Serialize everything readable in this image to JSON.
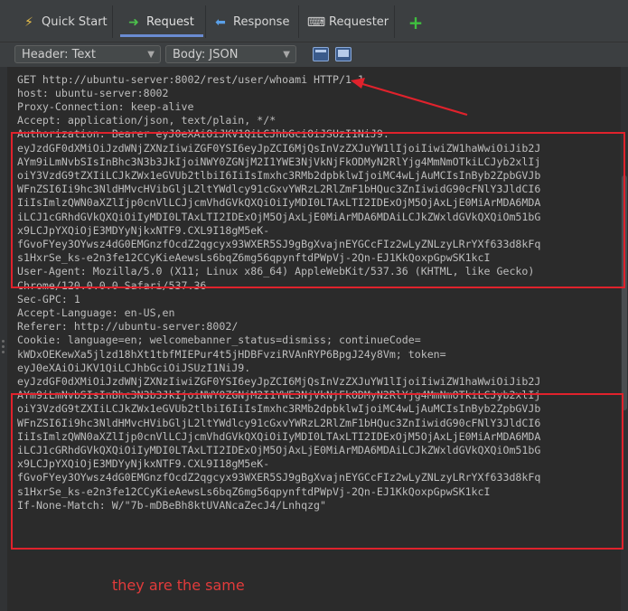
{
  "tabs": [
    {
      "label": "Quick Start",
      "icon": "lightning-icon"
    },
    {
      "label": "Request",
      "icon": "arrow-right-icon",
      "active": true
    },
    {
      "label": "Response",
      "icon": "arrow-left-icon"
    },
    {
      "label": "Requester",
      "icon": "requester-icon"
    }
  ],
  "add_tab_icon": "plus-icon",
  "toolbar": {
    "header_select": "Header: Text",
    "body_select": "Body: JSON"
  },
  "request_lines": [
    "GET http://ubuntu-server:8002/rest/user/whoami HTTP/1.1",
    "host: ubuntu-server:8002",
    "Proxy-Connection: keep-alive",
    "Accept: application/json, text/plain, */*",
    "Authorization: Bearer eyJ0eXAiOiJKV1QiLCJhbGciOiJSUzI1NiJ9.",
    "eyJzdGF0dXMiOiJzdWNjZXNzIiwiZGF0YSI6eyJpZCI6MjQsInVzZXJuYW1lIjoiIiwiZW1haWwiOiJib2J",
    "AYm9iLmNvbSIsInBhc3N3b3JkIjoiNWY0ZGNjM2I1YWE3NjVkNjFkODMyN2RlYjg4MmNmOTkiLCJyb2xlIj",
    "oiY3VzdG9tZXIiLCJkZWx1eGVUb2tlbiI6IiIsImxhc3RMb2dpbklwIjoiMC4wLjAuMCIsInByb2ZpbGVJb",
    "WFnZSI6Ii9hc3NldHMvcHVibGljL2ltYWdlcy91cGxvYWRzL2RlZmF1bHQuc3ZnIiwidG90cFNlY3JldCI6",
    "IiIsImlzQWN0aXZlIjp0cnVlLCJjcmVhdGVkQXQiOiIyMDI0LTAxLTI2IDExOjM5OjAxLjE0MiArMDA6MDA",
    "iLCJ1cGRhdGVkQXQiOiIyMDI0LTAxLTI2IDExOjM5OjAxLjE0MiArMDA6MDAiLCJkZWxldGVkQXQiOm51bG",
    "x9LCJpYXQiOjE3MDYyNjkxNTF9.CXL9I18gM5eK-",
    "fGvoFYey3OYwsz4dG0EMGnzfOcdZ2qgcyx93WXER5SJ9gBgXvajnEYGCcFIz2wLyZNLzyLRrYXf633d8kFq",
    "s1HxrSe_ks-e2n3fe12CCyKieAewsLs6bqZ6mg56qpynftdPWpVj-2Qn-EJ1KkQoxpGpwSK1kcI",
    "User-Agent: Mozilla/5.0 (X11; Linux x86_64) AppleWebKit/537.36 (KHTML, like Gecko)",
    "Chrome/120.0.0.0 Safari/537.36",
    "Sec-GPC: 1",
    "Accept-Language: en-US,en",
    "Referer: http://ubuntu-server:8002/",
    "Cookie: language=en; welcomebanner_status=dismiss; continueCode=",
    "kWDxOEKewXa5jlzd18hXt1tbfMIEPur4t5jHDBFvziRVAnRYP6BpgJ24y8Vm; token=",
    "eyJ0eXAiOiJKV1QiLCJhbGciOiJSUzI1NiJ9.",
    "eyJzdGF0dXMiOiJzdWNjZXNzIiwiZGF0YSI6eyJpZCI6MjQsInVzZXJuYW1lIjoiIiwiZW1haWwiOiJib2J",
    "AYm9iLmNvbSIsInBhc3N3b3JkIjoiNWY0ZGNjM2I1YWE3NjVkNjFkODMyN2RlYjg4MmNmOTkiLCJyb2xlIj",
    "oiY3VzdG9tZXIiLCJkZWx1eGVUb2tlbiI6IiIsImxhc3RMb2dpbklwIjoiMC4wLjAuMCIsInByb2ZpbGVJb",
    "WFnZSI6Ii9hc3NldHMvcHVibGljL2ltYWdlcy91cGxvYWRzL2RlZmF1bHQuc3ZnIiwidG90cFNlY3JldCI6",
    "IiIsImlzQWN0aXZlIjp0cnVlLCJjcmVhdGVkQXQiOiIyMDI0LTAxLTI2IDExOjM5OjAxLjE0MiArMDA6MDA",
    "iLCJ1cGRhdGVkQXQiOiIyMDI0LTAxLTI2IDExOjM5OjAxLjE0MiArMDA6MDAiLCJkZWxldGVkQXQiOm51bG",
    "x9LCJpYXQiOjE3MDYyNjkxNTF9.CXL9I18gM5eK-",
    "fGvoFYey3OYwsz4dG0EMGnzfOcdZ2qgcyx93WXER5SJ9gBgXvajnEYGCcFIz2wLyZNLzyLRrYXf633d8kFq",
    "s1HxrSe_ks-e2n3fe12CCyKieAewsLs6bqZ6mg56qpynftdPWpVj-2Qn-EJ1KkQoxpGpwSK1kcI",
    "If-None-Match: W/\"7b-mDBeBh8ktUVANcaZecJ4/Lnhqzg\""
  ],
  "annotation": "they are the same",
  "colors": {
    "annotation_red": "#e0222c",
    "tab_accent": "#6a8bd1",
    "plus_green": "#3fbf3f"
  }
}
